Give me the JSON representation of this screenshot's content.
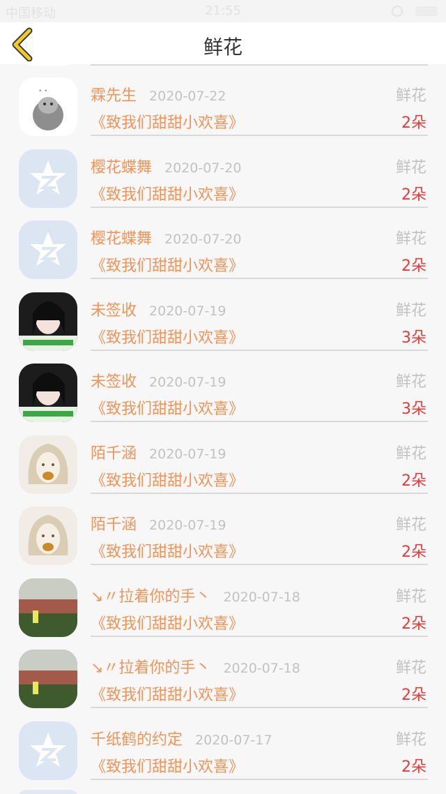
{
  "status_bar": {
    "carrier": "中国移动",
    "time": "21:55"
  },
  "header": {
    "title": "鲜花"
  },
  "colors": {
    "name": "#f0945a",
    "date": "#c2c2c2",
    "count": "#e23c3c",
    "divider": "#d9d9d9"
  },
  "gifts": [
    {
      "name": "霖先生",
      "date": "2020-07-22",
      "type": "鲜花",
      "title": "《致我们甜甜小欢喜》",
      "count": "2朵",
      "avatar": "penguin-avatar"
    },
    {
      "name": "樱花蝶舞",
      "date": "2020-07-20",
      "type": "鲜花",
      "title": "《致我们甜甜小欢喜》",
      "count": "2朵",
      "avatar": "qzone-star-avatar"
    },
    {
      "name": "樱花蝶舞",
      "date": "2020-07-20",
      "type": "鲜花",
      "title": "《致我们甜甜小欢喜》",
      "count": "2朵",
      "avatar": "qzone-star-avatar"
    },
    {
      "name": "未签收",
      "date": "2020-07-19",
      "type": "鲜花",
      "title": "《致我们甜甜小欢喜》",
      "count": "3朵",
      "avatar": "girl-photo-avatar"
    },
    {
      "name": "未签收",
      "date": "2020-07-19",
      "type": "鲜花",
      "title": "《致我们甜甜小欢喜》",
      "count": "3朵",
      "avatar": "girl-photo-avatar"
    },
    {
      "name": "陌千涵",
      "date": "2020-07-19",
      "type": "鲜花",
      "title": "《致我们甜甜小欢喜》",
      "count": "2朵",
      "avatar": "sketch-girl-avatar"
    },
    {
      "name": "陌千涵",
      "date": "2020-07-19",
      "type": "鲜花",
      "title": "《致我们甜甜小欢喜》",
      "count": "2朵",
      "avatar": "sketch-girl-avatar"
    },
    {
      "name": "↘〃拉着你的手丶",
      "date": "2020-07-18",
      "type": "鲜花",
      "title": "《致我们甜甜小欢喜》",
      "count": "2朵",
      "avatar": "garden-photo-avatar"
    },
    {
      "name": "↘〃拉着你的手丶",
      "date": "2020-07-18",
      "type": "鲜花",
      "title": "《致我们甜甜小欢喜》",
      "count": "2朵",
      "avatar": "garden-photo-avatar"
    },
    {
      "name": "千纸鹤的约定",
      "date": "2020-07-17",
      "type": "鲜花",
      "title": "《致我们甜甜小欢喜》",
      "count": "2朵",
      "avatar": "qzone-star-avatar"
    }
  ]
}
